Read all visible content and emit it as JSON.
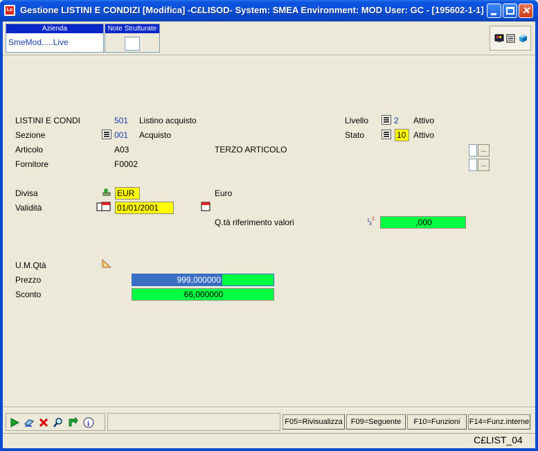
{
  "window": {
    "title": "Gestione LISTINI E CONDIZI [Modifica] -C£LISOD- System: SMEA Environment: MOD User: GC - [195602-1-1]"
  },
  "header": {
    "azienda_label": "Azienda",
    "azienda_value": "SmeMod.....Live",
    "note_label": "Note Strutturate"
  },
  "form": {
    "listini_label": "LISTINI E CONDI",
    "listini_code": "501",
    "listini_desc": "Listino acquisto",
    "livello_label": "Livello",
    "livello_value": "2",
    "livello_desc": "Attivo",
    "sezione_label": "Sezione",
    "sezione_code": "001",
    "sezione_desc": "Acquisto",
    "stato_label": "Stato",
    "stato_value": "10",
    "stato_desc": "Attivo",
    "articolo_label": "Articolo",
    "articolo_code": "A03",
    "articolo_desc": "TERZO ARTICOLO",
    "fornitore_label": "Fornitore",
    "fornitore_code": "F0002",
    "divisa_label": "Divisa",
    "divisa_value": "EUR",
    "divisa_desc": "Euro",
    "validita_label": "Validità",
    "validita_value": "01/01/2001",
    "qta_rif_label": "Q.tà riferimento valori",
    "qta_rif_value": ",000",
    "um_qta_label": "U.M.Qtà",
    "prezzo_label": "Prezzo",
    "prezzo_value": "999,000000",
    "sconto_label": "Sconto",
    "sconto_value": "66,000000"
  },
  "toolbar": {
    "icons": [
      "run-icon",
      "eraser-icon",
      "delete-icon",
      "search-icon",
      "refresh-icon",
      "info-icon"
    ]
  },
  "fkeys": {
    "f05": "F05=Rivisualizza",
    "f09": "F09=Seguente",
    "f10": "F10=Funzioni",
    "f14": "F14=Funz.interne"
  },
  "status": {
    "screen_id": "C£LIST_04"
  },
  "colors": {
    "title_bar": "#0a4fd6",
    "field_yellow": "#ffff00",
    "field_green": "#00ff40",
    "field_selected": "#3a6fc4",
    "value_blue": "#1b3da8"
  }
}
